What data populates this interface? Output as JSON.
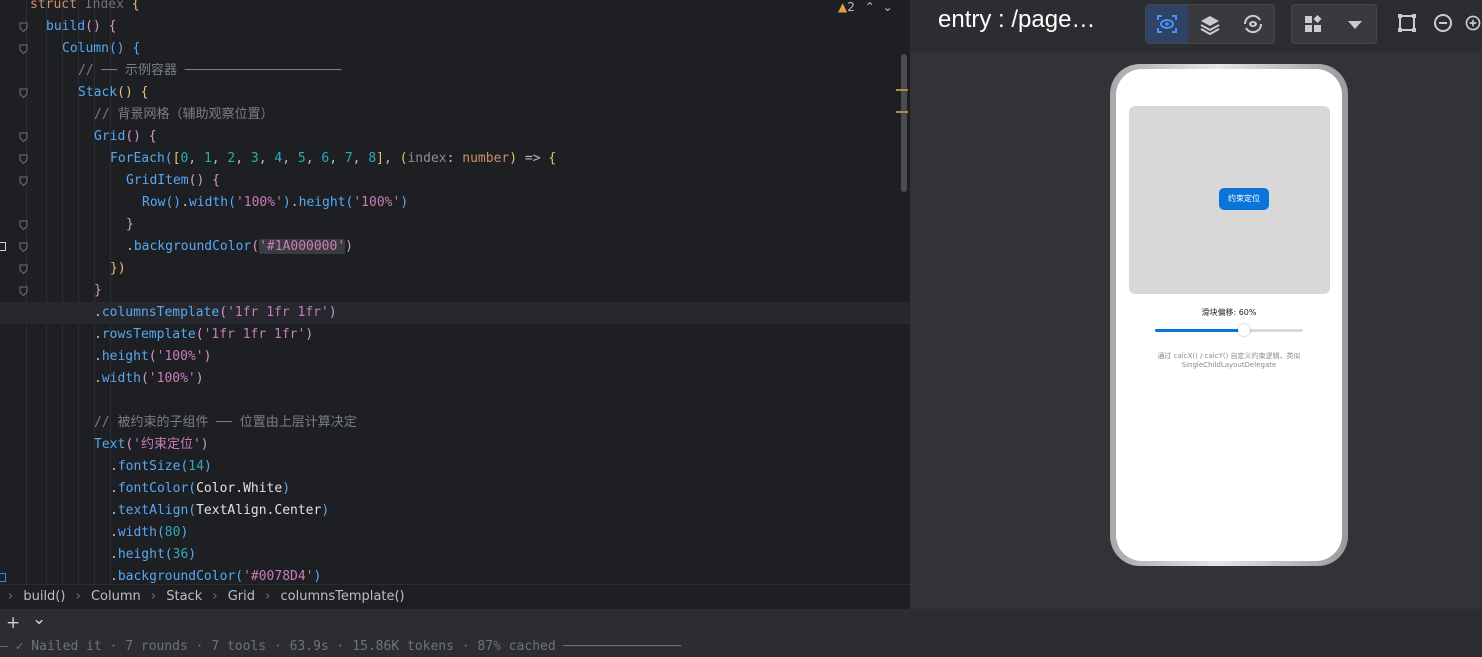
{
  "editor": {
    "warning": {
      "count": "2"
    },
    "lines": [
      {
        "tokens": [
          [
            "kw",
            "struct "
          ],
          [
            "ty",
            "Index "
          ],
          [
            "b1",
            "{"
          ]
        ]
      },
      {
        "tokens": [
          [
            "fn",
            "build"
          ],
          [
            "b2",
            "() "
          ],
          [
            "b2",
            "{"
          ]
        ]
      },
      {
        "tokens": [
          [
            "fn",
            "Column"
          ],
          [
            "b3",
            "() "
          ],
          [
            "b3",
            "{"
          ]
        ]
      },
      {
        "tokens": [
          [
            "cmt",
            "// ── 示例容器 ────────────────────"
          ]
        ]
      },
      {
        "tokens": [
          [
            "fn",
            "Stack"
          ],
          [
            "b1",
            "() "
          ],
          [
            "b1",
            "{"
          ]
        ]
      },
      {
        "tokens": [
          [
            "cmt",
            "// 背景网格（辅助观察位置）"
          ]
        ]
      },
      {
        "tokens": [
          [
            "fn",
            "Grid"
          ],
          [
            "b2",
            "() "
          ],
          [
            "b2",
            "{"
          ]
        ]
      },
      {
        "tokens": [
          [
            "fn",
            "ForEach"
          ],
          [
            "b3",
            "("
          ],
          [
            "b1",
            "["
          ],
          [
            "num",
            "0"
          ],
          [
            "def",
            ", "
          ],
          [
            "num",
            "1"
          ],
          [
            "def",
            ", "
          ],
          [
            "num",
            "2"
          ],
          [
            "def",
            ", "
          ],
          [
            "num",
            "3"
          ],
          [
            "def",
            ", "
          ],
          [
            "num",
            "4"
          ],
          [
            "def",
            ", "
          ],
          [
            "num",
            "5"
          ],
          [
            "def",
            ", "
          ],
          [
            "num",
            "6"
          ],
          [
            "def",
            ", "
          ],
          [
            "num",
            "7"
          ],
          [
            "def",
            ", "
          ],
          [
            "num",
            "8"
          ],
          [
            "b1",
            "]"
          ],
          [
            "def",
            ", "
          ],
          [
            "b1",
            "("
          ],
          [
            "param",
            "index"
          ],
          [
            "def",
            ": "
          ],
          [
            "tyk",
            "number"
          ],
          [
            "b1",
            ")"
          ],
          [
            "def",
            " => "
          ],
          [
            "b1",
            "{"
          ]
        ]
      },
      {
        "tokens": [
          [
            "fn",
            "GridItem"
          ],
          [
            "b2",
            "() "
          ],
          [
            "b2",
            "{"
          ]
        ]
      },
      {
        "tokens": [
          [
            "fn",
            "Row"
          ],
          [
            "b3",
            "()"
          ],
          [
            "def",
            "."
          ],
          [
            "fn",
            "width"
          ],
          [
            "b3",
            "("
          ],
          [
            "str",
            "'100%'"
          ],
          [
            "b3",
            ")"
          ],
          [
            "def",
            "."
          ],
          [
            "fn",
            "height"
          ],
          [
            "b3",
            "("
          ],
          [
            "str",
            "'100%'"
          ],
          [
            "b3",
            ")"
          ]
        ]
      },
      {
        "tokens": [
          [
            "b2",
            "}"
          ]
        ]
      },
      {
        "tokens": [
          [
            "def",
            "."
          ],
          [
            "fn",
            "backgroundColor"
          ],
          [
            "b2",
            "("
          ],
          [
            "strhl",
            "'#1A000000'"
          ],
          [
            "b2",
            ")"
          ]
        ]
      },
      {
        "tokens": [
          [
            "b1",
            "})"
          ]
        ]
      },
      {
        "tokens": [
          [
            "b2",
            "}"
          ]
        ]
      },
      {
        "tokens": [
          [
            "def",
            "."
          ],
          [
            "fn",
            "columnsTemplate"
          ],
          [
            "b2",
            "("
          ],
          [
            "str",
            "'1fr 1fr 1fr'"
          ],
          [
            "b2",
            ")"
          ]
        ]
      },
      {
        "tokens": [
          [
            "def",
            "."
          ],
          [
            "fn",
            "rowsTemplate"
          ],
          [
            "b2",
            "("
          ],
          [
            "str",
            "'1fr 1fr 1fr'"
          ],
          [
            "b2",
            ")"
          ]
        ]
      },
      {
        "tokens": [
          [
            "def",
            "."
          ],
          [
            "fn",
            "height"
          ],
          [
            "b2",
            "("
          ],
          [
            "str",
            "'100%'"
          ],
          [
            "b2",
            ")"
          ]
        ]
      },
      {
        "tokens": [
          [
            "def",
            "."
          ],
          [
            "fn",
            "width"
          ],
          [
            "b2",
            "("
          ],
          [
            "str",
            "'100%'"
          ],
          [
            "b2",
            ")"
          ]
        ]
      },
      {
        "tokens": []
      },
      {
        "tokens": [
          [
            "cmt",
            "// 被约束的子组件 ── 位置由上层计算决定"
          ]
        ]
      },
      {
        "tokens": [
          [
            "fn",
            "Text"
          ],
          [
            "b2",
            "("
          ],
          [
            "str",
            "'约束定位'"
          ],
          [
            "b2",
            ")"
          ]
        ]
      },
      {
        "tokens": [
          [
            "def",
            "."
          ],
          [
            "fn",
            "fontSize"
          ],
          [
            "b3",
            "("
          ],
          [
            "num",
            "14"
          ],
          [
            "b3",
            ")"
          ]
        ]
      },
      {
        "tokens": [
          [
            "def",
            "."
          ],
          [
            "fn",
            "fontColor"
          ],
          [
            "b3",
            "("
          ],
          [
            "white",
            "Color.White"
          ],
          [
            "b3",
            ")"
          ]
        ]
      },
      {
        "tokens": [
          [
            "def",
            "."
          ],
          [
            "fn",
            "textAlign"
          ],
          [
            "b3",
            "("
          ],
          [
            "white",
            "TextAlign.Center"
          ],
          [
            "b3",
            ")"
          ]
        ]
      },
      {
        "tokens": [
          [
            "def",
            "."
          ],
          [
            "fn",
            "width"
          ],
          [
            "b3",
            "("
          ],
          [
            "num",
            "80"
          ],
          [
            "b3",
            ")"
          ]
        ]
      },
      {
        "tokens": [
          [
            "def",
            "."
          ],
          [
            "fn",
            "height"
          ],
          [
            "b3",
            "("
          ],
          [
            "num",
            "36"
          ],
          [
            "b3",
            ")"
          ]
        ]
      },
      {
        "tokens": [
          [
            "def",
            "."
          ],
          [
            "fn",
            "backgroundColor"
          ],
          [
            "b3",
            "("
          ],
          [
            "str",
            "'#0078D4'"
          ],
          [
            "b3",
            ")"
          ]
        ]
      }
    ]
  },
  "breadcrumb": [
    "build()",
    "Column",
    "Stack",
    "Grid",
    "columnsTemplate()"
  ],
  "toolbar2": {
    "add": "+",
    "chevron": "⌄"
  },
  "statusline": "— ✓ Nailed it · 7 rounds · 7 tools · 63.9s · 15.86K tokens · 87% cached ───────────────",
  "preview": {
    "title": "entry : /page…",
    "phone": {
      "button_label": "约束定位",
      "slider_label": "滑块偏移: 60%",
      "slider_value": 0.6,
      "description": "通过 calcX() / calcY() 自定义约束逻辑，类似 SingleChildLayoutDelegate"
    }
  }
}
